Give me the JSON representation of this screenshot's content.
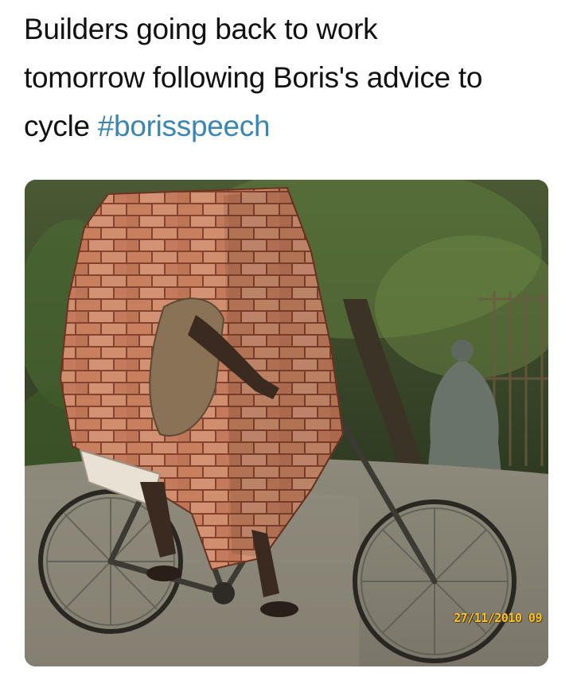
{
  "post": {
    "text_line1": "Builders going back to work",
    "text_line2": "tomorrow following Boris's advice to",
    "text_line3_prefix": "cycle ",
    "hashtag": "#borisspeech",
    "hashtag_color": "#3b86b0"
  },
  "photo": {
    "subject": "man-cycling-with-bricks",
    "timestamp": "27/11/2010 09"
  }
}
